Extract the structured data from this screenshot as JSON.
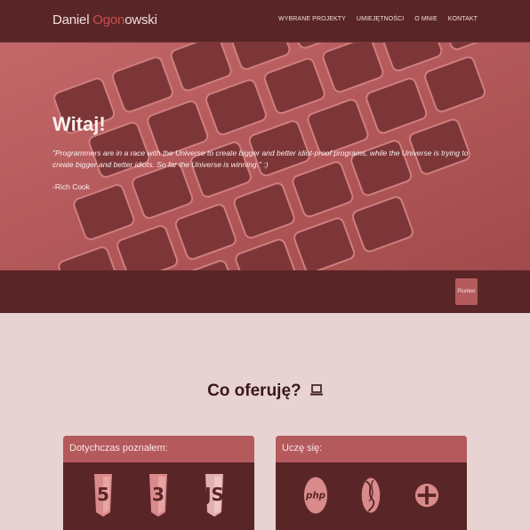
{
  "brand": {
    "part1": "Daniel ",
    "part2": "Ogon",
    "part3": "owski"
  },
  "nav": [
    {
      "label": "WYBRANE PROJEKTY"
    },
    {
      "label": "UMIEJĘTNOŚCI"
    },
    {
      "label": "O MNIE"
    },
    {
      "label": "KONTAKT"
    }
  ],
  "hero": {
    "title": "Witaj!",
    "quote": "\"Programmers are in a race with the Universe to create bigger and better idiot-proof programs, while the Universe is trying to create bigger and better idiots. So far the Universe is winning.\" :)",
    "author": "-Rich Cook"
  },
  "band": {
    "button_label": "Plunker"
  },
  "offer": {
    "title": "Co oferuję?"
  },
  "cards": [
    {
      "header": "Dotychczas poznałem:",
      "icons": [
        "html5-icon",
        "css3-icon",
        "javascript-icon"
      ]
    },
    {
      "header": "Uczę się:",
      "icons": [
        "php-icon",
        "mysql-icon",
        "plus-icon"
      ]
    }
  ],
  "colors": {
    "dark": "#5a2526",
    "accent": "#b55a5c",
    "page_bg": "#e8d3d3"
  }
}
